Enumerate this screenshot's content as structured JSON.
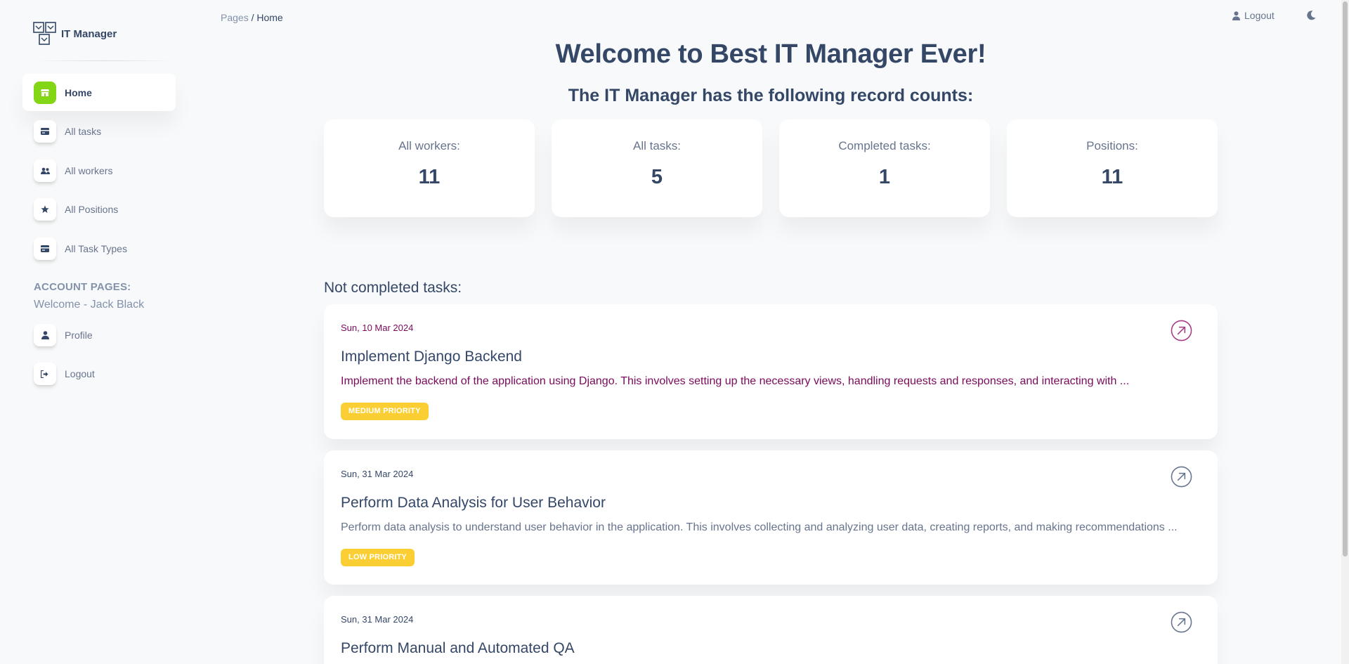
{
  "brand": {
    "name": "IT Manager"
  },
  "sidebar": {
    "items": [
      {
        "label": "Home",
        "icon": "shop-icon",
        "active": true
      },
      {
        "label": "All tasks",
        "icon": "credit-card-icon",
        "active": false
      },
      {
        "label": "All workers",
        "icon": "users-icon",
        "active": false
      },
      {
        "label": "All Positions",
        "icon": "star-icon",
        "active": false
      },
      {
        "label": "All Task Types",
        "icon": "credit-card-icon",
        "active": false
      }
    ],
    "account_heading": "ACCOUNT PAGES:",
    "welcome": "Welcome - Jack Black",
    "account_items": [
      {
        "label": "Profile",
        "icon": "user-icon"
      },
      {
        "label": "Logout",
        "icon": "sign-out-icon"
      }
    ]
  },
  "breadcrumb": {
    "root": "Pages",
    "separator": "/",
    "current": "Home"
  },
  "topbar": {
    "logout_label": "Logout"
  },
  "main": {
    "title": "Welcome to Best IT Manager Ever!",
    "subtitle": "The IT Manager has the following record counts:",
    "stats": [
      {
        "label": "All workers:",
        "value": "11"
      },
      {
        "label": "All tasks:",
        "value": "5"
      },
      {
        "label": "Completed tasks:",
        "value": "1"
      },
      {
        "label": "Positions:",
        "value": "11"
      }
    ],
    "section_title": "Not completed tasks:",
    "tasks": [
      {
        "date": "Sun, 10 Mar 2024",
        "title": "Implement Django Backend",
        "description": "Implement the backend of the application using Django. This involves setting up the necessary views, handling requests and responses, and interacting with ...",
        "priority": "MEDIUM PRIORITY"
      },
      {
        "date": "Sun, 31 Mar 2024",
        "title": "Perform Data Analysis for User Behavior",
        "description": "Perform data analysis to understand user behavior in the application. This involves collecting and analyzing user data, creating reports, and making recommendations ...",
        "priority": "LOW PRIORITY"
      },
      {
        "date": "Sun, 31 Mar 2024",
        "title": "Perform Manual and Automated QA"
      }
    ]
  },
  "colors": {
    "accent_green": "#82d616",
    "text_dark": "#344767",
    "text_muted": "#67748e",
    "badge_yellow": "#fbcf33",
    "highlight_purple": "#7a0a5c"
  }
}
